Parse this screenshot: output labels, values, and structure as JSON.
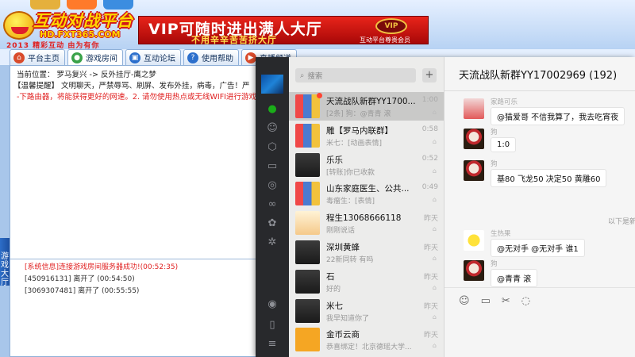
{
  "platform": {
    "logo": {
      "main": "互动对战平台",
      "url": "HD.FXT365.COM",
      "sub": "2013 精彩互动 由为有你"
    },
    "banner": {
      "main": "VIP可随时进出满人大厅",
      "sub": "不用辛辛苦苦挤大厅",
      "badge": "VIP",
      "caption": "互动平台尊贵会员"
    },
    "nav": [
      {
        "label": "平台主页",
        "icon": "home-icon",
        "color": "#d94b2b"
      },
      {
        "label": "游戏房间",
        "icon": "gamepad-icon",
        "color": "#3aa24a"
      },
      {
        "label": "互动论坛",
        "icon": "forum-icon",
        "color": "#2c6fcc"
      },
      {
        "label": "使用帮助",
        "icon": "help-icon",
        "color": "#2c6fcc"
      },
      {
        "label": "直播频道",
        "icon": "broadcast-icon",
        "color": "#d94b2b"
      }
    ],
    "location": "当前位置： 罗马复兴 -> 反外挂厅-鹰之梦",
    "notice": "【温馨提醒】 文明聊天，严禁辱骂、刷屏、发布外挂，病毒，广告！严",
    "notice2": "-下路由器，将能获得更好的网速。2. 请勿使用热点或无线WIFI进行游戏。",
    "log": [
      {
        "text": "[系统信息]连接游戏房间服务器成功!(00:52:35)",
        "red": true
      },
      {
        "text": "[450916131] 离开了 (00:54:50)",
        "red": false
      },
      {
        "text": "[3069307481] 离开了 (00:55:55)",
        "red": false
      }
    ],
    "side_tab": "游戏大厅"
  },
  "wechat": {
    "search_placeholder": "搜索",
    "plus": "+",
    "conversations": [
      {
        "name": "天流战队新群YY1700...",
        "preview": "[2条] 狗：@青青 滚",
        "time": "1:00",
        "avatar": "av-grid",
        "active": true,
        "dot": true
      },
      {
        "name": "雕【罗马内联群】",
        "preview": "米七：[动画表情]",
        "time": "0:58",
        "avatar": "av-grid",
        "active": false,
        "dot": false
      },
      {
        "name": "乐乐",
        "preview": "[转账]你已收款",
        "time": "0:52",
        "avatar": "av-dark",
        "active": false,
        "dot": false
      },
      {
        "name": "山东家庭医生、公共...",
        "preview": "毒瘤生：[表情]",
        "time": "0:49",
        "avatar": "av-grid",
        "active": false,
        "dot": false
      },
      {
        "name": "程生13068666118",
        "preview": "刚刚说话",
        "time": "昨天",
        "avatar": "av-cat",
        "active": false,
        "dot": false
      },
      {
        "name": "深圳黄蜂",
        "preview": "22新同转 有吗",
        "time": "昨天",
        "avatar": "av-dark",
        "active": false,
        "dot": false
      },
      {
        "name": "石",
        "preview": "好的",
        "time": "昨天",
        "avatar": "av-dark",
        "active": false,
        "dot": false
      },
      {
        "name": "米七",
        "preview": "我早知道你了",
        "time": "昨天",
        "avatar": "av-dark",
        "active": false,
        "dot": false
      },
      {
        "name": "金币云商",
        "preview": "恭喜绑定！北京德瑶大学...",
        "time": "昨天",
        "avatar": "av-fox",
        "active": false,
        "dot": false
      }
    ],
    "chat": {
      "title": "天流战队新群YY17002969 (192)",
      "messages": [
        {
          "nick": "家路可乐",
          "text": "@猫爱哥 不信我算了，我去吃宵夜",
          "avatar": "av-red"
        },
        {
          "nick": "狗",
          "text": "1:0",
          "avatar": "av-joker"
        },
        {
          "nick": "狗",
          "text": "基80 飞龙50 决定50 黄雕60",
          "avatar": "av-joker"
        },
        {
          "nick": "生热果",
          "text": "@无对手 @无对手 谁1",
          "avatar": "av-pika"
        },
        {
          "nick": "狗",
          "text": "@青青 滚",
          "avatar": "av-joker"
        }
      ],
      "separator": "以下是新",
      "toolbar": [
        "emoji-icon",
        "folder-icon",
        "scissors-icon",
        "chat-more-icon"
      ]
    },
    "rail_icons": [
      "chat-icon",
      "contacts-icon",
      "box-icon",
      "folder-icon",
      "favorites-icon",
      "moments-icon",
      "settings-icon",
      "sparkle-icon",
      "phone-icon",
      "menu-icon"
    ]
  }
}
